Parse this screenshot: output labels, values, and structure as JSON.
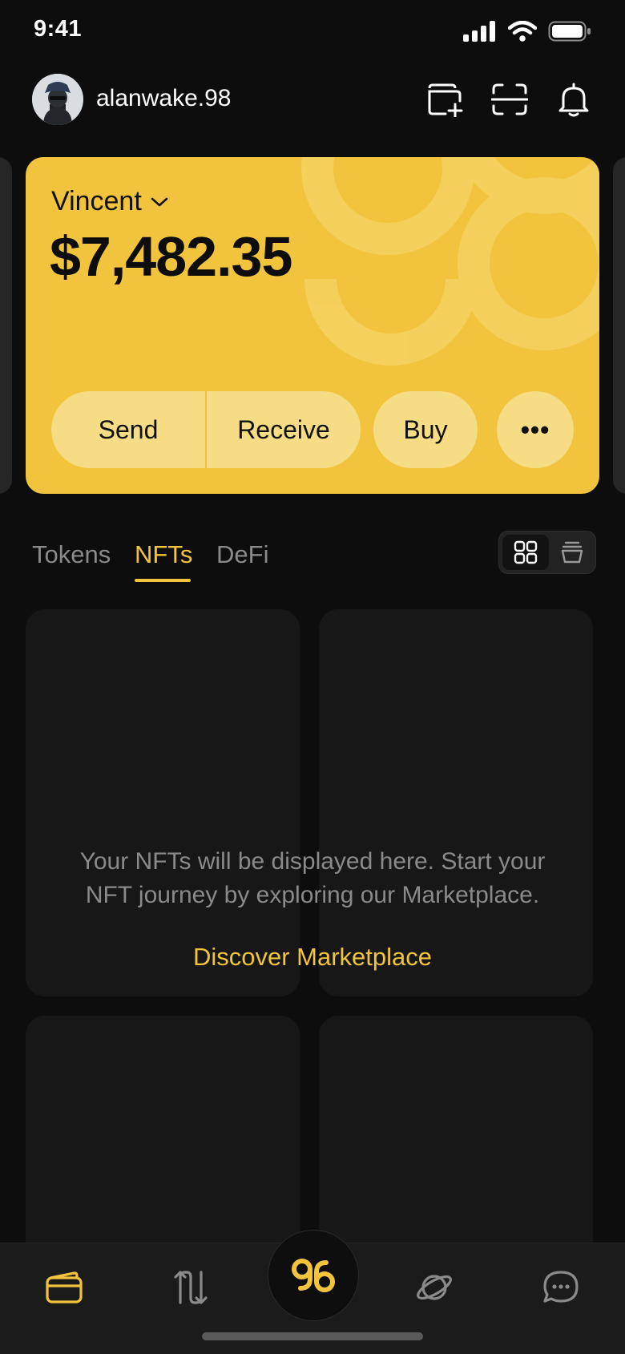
{
  "status_bar": {
    "time": "9:41"
  },
  "header": {
    "username": "alanwake.98"
  },
  "wallet_card": {
    "account_name": "Vincent",
    "balance": "$7,482.35",
    "actions": {
      "send": "Send",
      "receive": "Receive",
      "buy": "Buy",
      "more": "•••"
    }
  },
  "tabs": [
    {
      "label": "Tokens",
      "active": false
    },
    {
      "label": "NFTs",
      "active": true
    },
    {
      "label": "DeFi",
      "active": false
    }
  ],
  "nft_empty": {
    "line1": "Your NFTs will be displayed here. Start your",
    "line2": "NFT journey by exploring our Marketplace.",
    "cta": "Discover Marketplace"
  },
  "bottom_nav": {
    "items": [
      "wallet-icon",
      "swap-icon",
      "brand-logo-icon",
      "explore-icon",
      "chat-icon"
    ],
    "center_logo": "98",
    "active": "wallet-icon"
  },
  "colors": {
    "accent": "#f2c43d",
    "background": "#0d0d0d",
    "card_button": "#f6dc85"
  }
}
